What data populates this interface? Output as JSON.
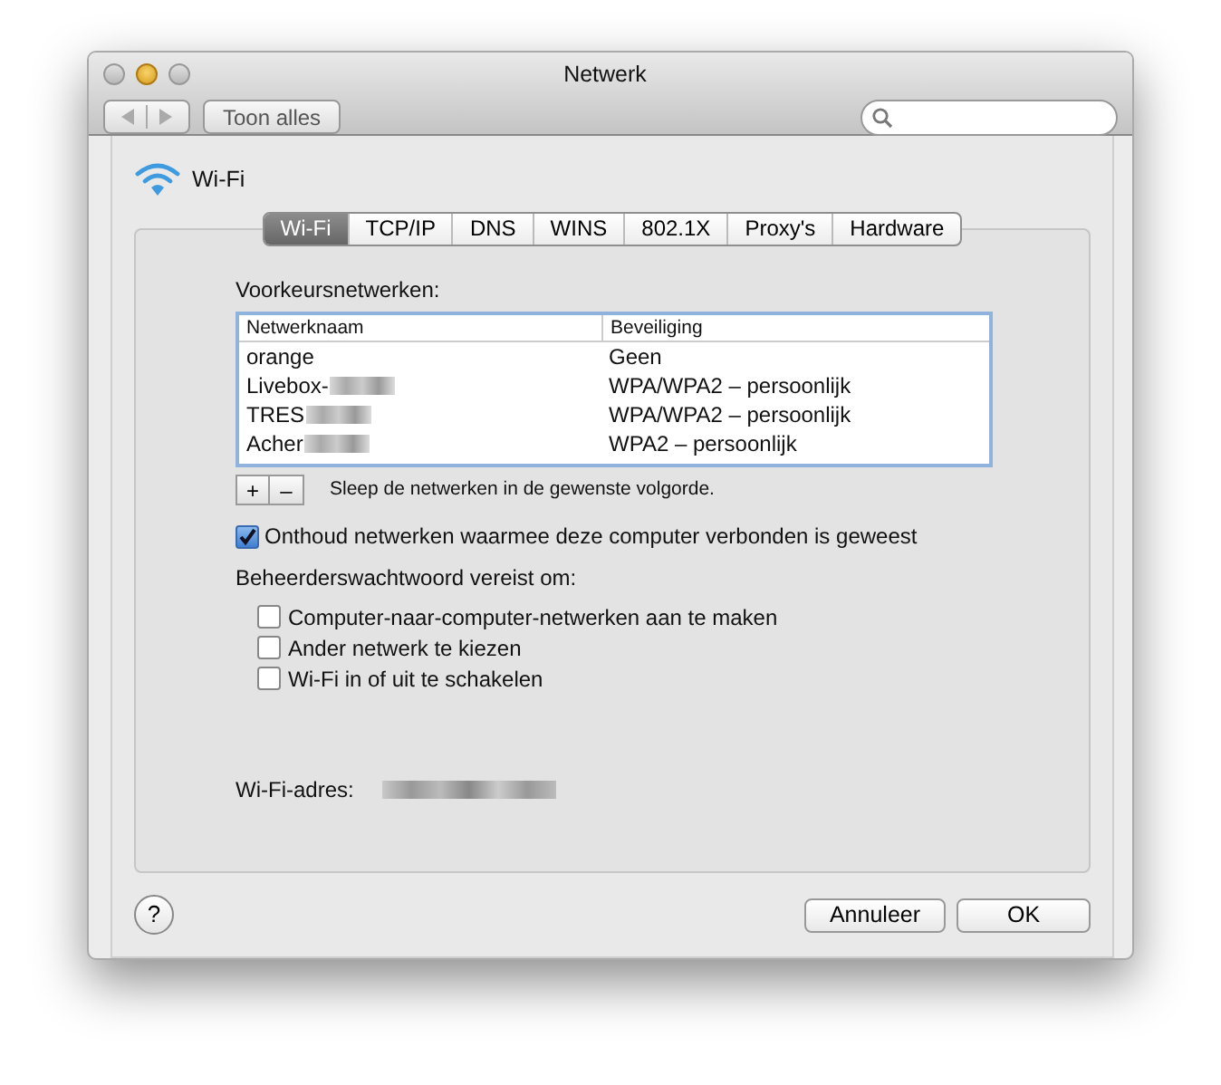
{
  "window": {
    "title": "Netwerk",
    "toolbar": {
      "show_all_button": "Toon alles"
    }
  },
  "service": {
    "name": "Wi-Fi"
  },
  "tabs": [
    {
      "label": "Wi-Fi",
      "selected": true
    },
    {
      "label": "TCP/IP",
      "selected": false
    },
    {
      "label": "DNS",
      "selected": false
    },
    {
      "label": "WINS",
      "selected": false
    },
    {
      "label": "802.1X",
      "selected": false
    },
    {
      "label": "Proxy's",
      "selected": false
    },
    {
      "label": "Hardware",
      "selected": false
    }
  ],
  "preferred_networks": {
    "label": "Voorkeursnetwerken:",
    "columns": [
      "Netwerknaam",
      "Beveiliging"
    ],
    "rows": [
      {
        "name": "orange",
        "redacted": false,
        "security": "Geen"
      },
      {
        "name": "Livebox-",
        "redacted": true,
        "security": "WPA/WPA2 – persoonlijk"
      },
      {
        "name": "TRES",
        "redacted": true,
        "security": "WPA/WPA2 – persoonlijk"
      },
      {
        "name": "Acher",
        "redacted": true,
        "security": "WPA2 – persoonlijk"
      }
    ],
    "add_button": "+",
    "remove_button": "–",
    "hint": "Sleep de netwerken in de gewenste volgorde."
  },
  "remember_networks": {
    "label": "Onthoud netwerken waarmee deze computer verbonden is geweest",
    "checked": true
  },
  "admin_label": "Beheerderswachtwoord vereist om:",
  "admin_options": [
    {
      "label": "Computer-naar-computer-netwerken aan te maken",
      "checked": false
    },
    {
      "label": "Ander netwerk te kiezen",
      "checked": false
    },
    {
      "label": "Wi-Fi in of uit te schakelen",
      "checked": false
    }
  ],
  "wifi_address": {
    "label": "Wi-Fi-adres:"
  },
  "buttons": {
    "help": "?",
    "cancel": "Annuleer",
    "ok": "OK"
  }
}
